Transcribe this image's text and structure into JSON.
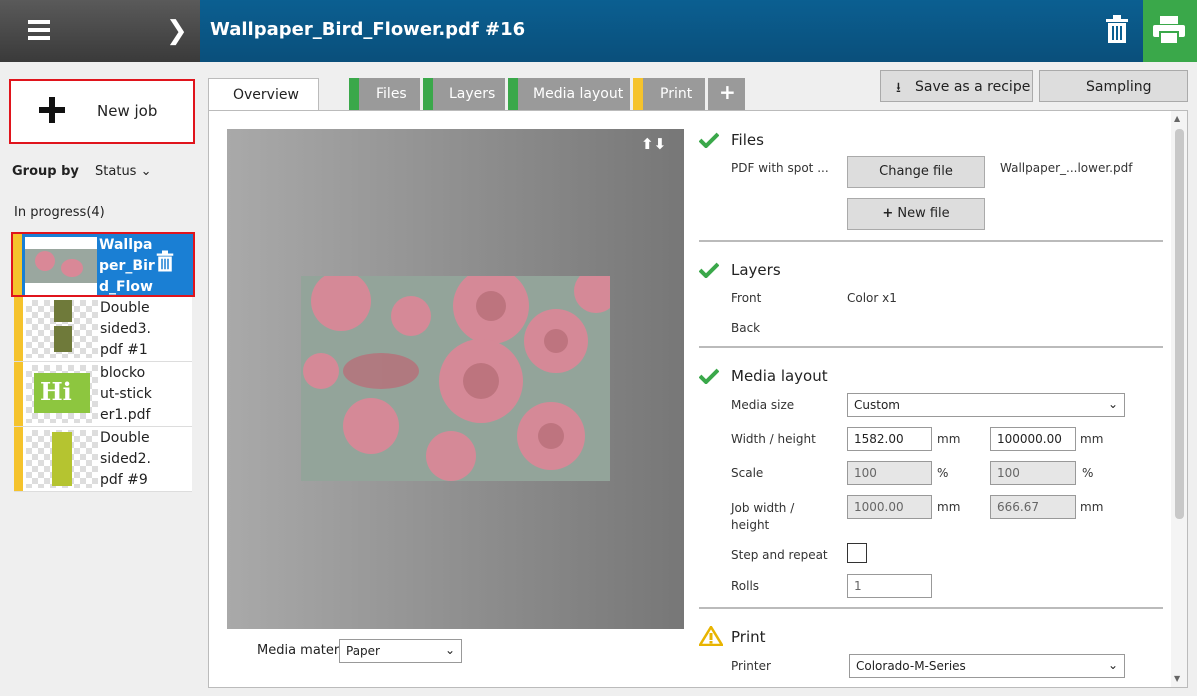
{
  "header": {
    "title": "Wallpaper_Bird_Flower.pdf #16"
  },
  "sidebar": {
    "new_job_label": "New job",
    "group_by_label": "Group by",
    "group_by_value": "Status",
    "section_label": "In progress(4)",
    "jobs": [
      {
        "name": "Wallpa per_Bir d_Flow",
        "name_lines": [
          "Wallpa",
          "per_Bir",
          "d_Flow"
        ]
      },
      {
        "name_lines": [
          "Double",
          "sided3.",
          "pdf #1"
        ]
      },
      {
        "name_lines": [
          "blocko",
          "ut-stick",
          "er1.pdf"
        ]
      },
      {
        "name_lines": [
          "Double",
          "sided2.",
          "pdf #9"
        ]
      }
    ]
  },
  "tabs": {
    "overview": "Overview",
    "files": "Files",
    "layers": "Layers",
    "media_layout": "Media layout",
    "print": "Print",
    "add": "+",
    "save_recipe": "Save as a recipe",
    "sampling": "Sampling"
  },
  "preview": {
    "media_material_label": "Media material",
    "media_material_value": "Paper"
  },
  "files": {
    "title": "Files",
    "pdf_label": "PDF with spot ...",
    "change_file": "Change file",
    "file_name": "Wallpaper_...lower.pdf",
    "new_file": "New file"
  },
  "layers": {
    "title": "Layers",
    "front_label": "Front",
    "front_value": "Color x1",
    "back_label": "Back"
  },
  "media_layout": {
    "title": "Media layout",
    "media_size_label": "Media size",
    "media_size_value": "Custom",
    "width_height_label": "Width / height",
    "width": "1582.00",
    "height": "100000.00",
    "unit_mm": "mm",
    "scale_label": "Scale",
    "scale_x": "100",
    "scale_y": "100",
    "unit_pct": "%",
    "job_wh_label": "Job width / height",
    "job_width": "1000.00",
    "job_height": "666.67",
    "step_repeat_label": "Step and repeat",
    "rolls_label": "Rolls",
    "rolls_value": "1"
  },
  "print": {
    "title": "Print",
    "printer_label": "Printer",
    "printer_value": "Colorado-M-Series"
  },
  "colors": {
    "accent": "#1a7fd4",
    "header_blue": "#0b5f91",
    "ok_green": "#3aa84a",
    "warn_yellow": "#f5c32c",
    "highlight_red": "#e0141c"
  }
}
